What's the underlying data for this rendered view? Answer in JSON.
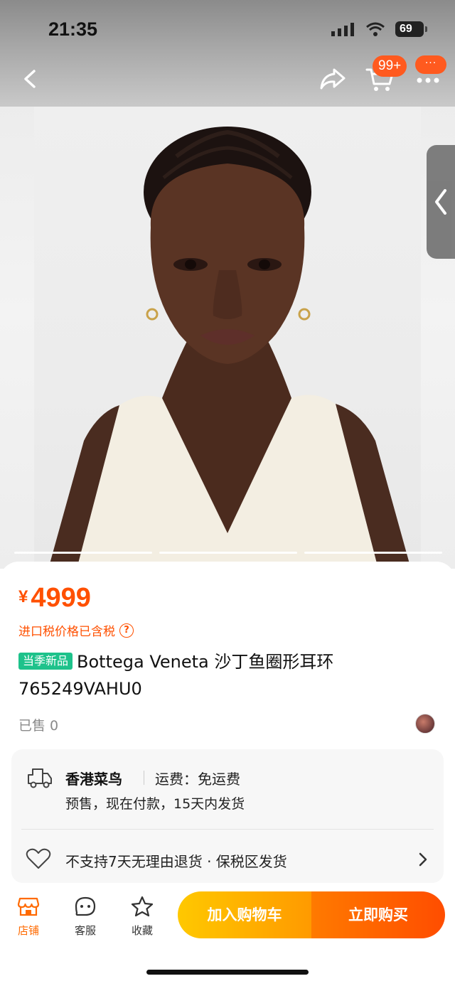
{
  "status_bar": {
    "time": "21:35",
    "battery": "69"
  },
  "nav": {
    "cart_badge": "99+",
    "more_badge": "···"
  },
  "product": {
    "currency": "¥",
    "price": "4999",
    "tax_note": "进口税价格已含税",
    "tag": "当季新品",
    "title": "Bottega Veneta 沙丁鱼圈形耳环 765249VAHU0",
    "sold": "已售 0"
  },
  "shipping": {
    "provider": "香港菜鸟",
    "fee": "运费：免运费",
    "note": "预售，现在付款，15天内发货",
    "returns": "不支持7天无理由退货 · 保税区发货"
  },
  "bottom_bar": {
    "store": "店铺",
    "service": "客服",
    "favorite": "收藏",
    "add_to_cart": "加入购物车",
    "buy_now": "立即购买"
  },
  "colors": {
    "accent": "#ff5000",
    "new_tag": "#1ec28b",
    "cart_button": "#ffb000",
    "buy_button": "#ff5a00"
  },
  "icons": [
    "back-icon",
    "share-icon",
    "cart-icon",
    "more-icon",
    "side-drawer-icon",
    "help-icon",
    "truck-icon",
    "heart-icon",
    "chevron-right-icon",
    "store-icon",
    "service-icon",
    "star-icon"
  ],
  "gallery": {
    "pages": 3,
    "active_page": 1
  }
}
